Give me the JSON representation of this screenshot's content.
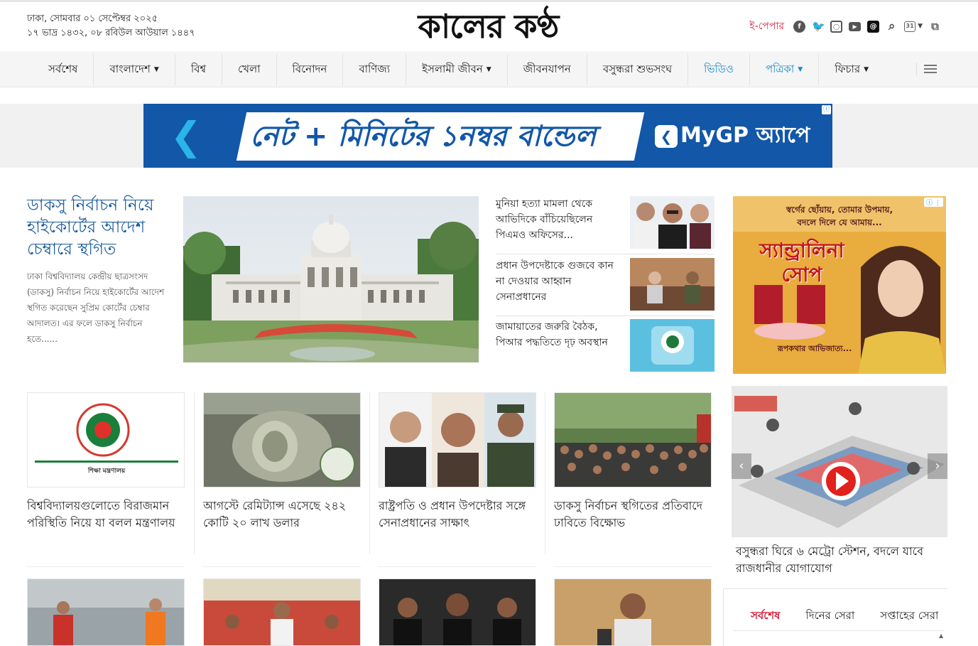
{
  "header": {
    "date_line1": "ঢাকা, সোমবার ০১ সেপ্টেম্বর ২০২৫",
    "date_line2": "১৭ ভাদ্র ১৪৩২, ০৮ রবিউল আউয়াল ১৪৪৭",
    "logo": "কালের কণ্ঠ",
    "epaper": "ই-পেপার",
    "icons": [
      "facebook-icon",
      "twitter-icon",
      "instagram-icon",
      "youtube-icon",
      "threads-icon",
      "search-icon",
      "calendar-icon",
      "language-icon"
    ]
  },
  "nav": [
    {
      "label": "সর্বশেষ",
      "dropdown": false
    },
    {
      "label": "বাংলাদেশ",
      "dropdown": true
    },
    {
      "label": "বিশ্ব",
      "dropdown": false
    },
    {
      "label": "খেলা",
      "dropdown": false
    },
    {
      "label": "বিনোদন",
      "dropdown": false
    },
    {
      "label": "বাণিজ্য",
      "dropdown": false
    },
    {
      "label": "ইসলামী জীবন",
      "dropdown": true
    },
    {
      "label": "জীবনযাপন",
      "dropdown": false
    },
    {
      "label": "বসুন্ধরা শুভসংঘ",
      "dropdown": false
    },
    {
      "label": "ভিডিও",
      "dropdown": false
    },
    {
      "label": "পত্রিকা",
      "dropdown": true
    },
    {
      "label": "ফিচার",
      "dropdown": true
    }
  ],
  "top_ad": {
    "headline": "নেট + মিনিটের ১নম্বর বান্ডেল",
    "app_label": "MyGP অ্যাপে",
    "colors": {
      "bg": "#1257a8",
      "accent": "#29b5ea"
    }
  },
  "lead": {
    "title": "ডাকসু নির্বাচন নিয়ে হাইকোর্টের আদেশ চেম্বারে স্থগিত",
    "summary": "ঢাকা বিশ্ববিদ্যালয় কেন্দ্রীয় ছাত্রসংসদ (ডাকসু) নির্বাচন নিয়ে হাইকোর্টের আদেশ স্থগিত করেছেন সুপ্রিম কোর্টের চেম্বার আদালত। এর ফলে ডাকসু নির্বাচন হতে......"
  },
  "side_news": [
    {
      "title": "মুনিয়া হত্যা মামলা থেকে আভিদিকে বাঁচিয়েছিলেন পিএমও অফিসের..."
    },
    {
      "title": "প্রধান উপদেষ্টাকে গুজবে কান না দেওয়ার আহ্বান সেনাপ্রধানের"
    },
    {
      "title": "জামায়াতের জরুরি বৈঠক, পিআর পদ্ধতিতে দৃঢ় অবস্থান"
    }
  ],
  "right_ad": {
    "line1": "স্বর্গের ছোঁয়ায়, তোমার উপমায়,",
    "line2": "বদলে দিলে যে আমায়...",
    "brand": "স্যান্ড্রালিনা সোপ",
    "tagline": "রূপকথার আভিজাত্য..."
  },
  "cards": [
    {
      "title": "বিশ্ববিদ্যালয়গুলোতে বিরাজমান পরিস্থিতি নিয়ে যা বলল মন্ত্রণালয়",
      "img_text": "শিক্ষা মন্ত্রণালয়"
    },
    {
      "title": "আগস্টে রেমিট্যান্স এসেছে ২৪২ কোটি ২০ লাখ ডলার"
    },
    {
      "title": "রাষ্ট্রপতি ও প্রধান উপদেষ্টার সঙ্গে সেনাপ্রধানের সাক্ষাৎ"
    },
    {
      "title": "ডাকসু নির্বাচন স্থগিতের প্রতিবাদে ঢাবিতে বিক্ষোভ"
    }
  ],
  "video": {
    "title": "বসুন্ধরা ঘিরে ৬ মেট্রো স্টেশন, বদলে যাবে রাজধানীর যোগাযোগ"
  },
  "tabs": [
    "সর্বশেষ",
    "দিনের সেরা",
    "সপ্তাহের সেরা"
  ]
}
